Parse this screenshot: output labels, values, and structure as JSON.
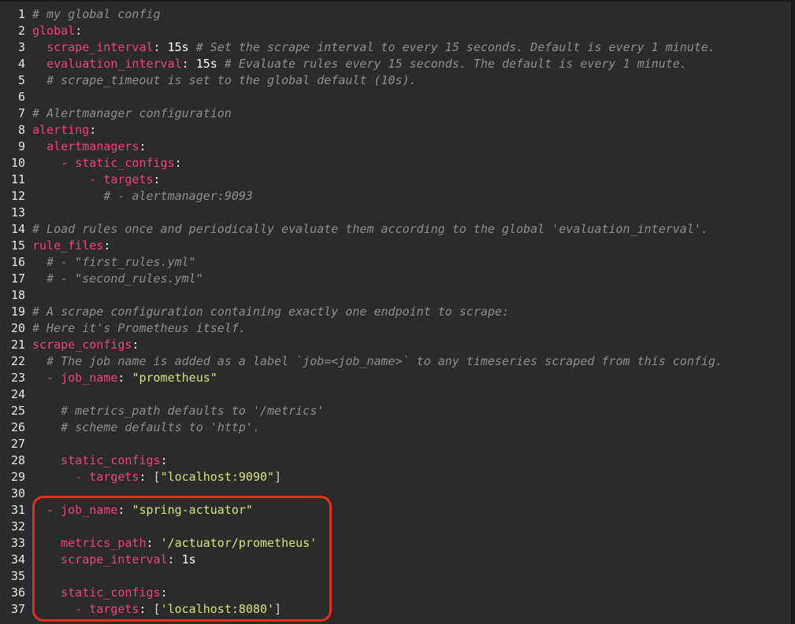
{
  "editor": {
    "lines": [
      {
        "num": "1",
        "indent": "",
        "tokens": [
          {
            "t": "c",
            "v": "# my global config"
          }
        ]
      },
      {
        "num": "2",
        "indent": "",
        "tokens": [
          {
            "t": "k",
            "v": "global"
          },
          {
            "t": "p",
            "v": ":"
          }
        ]
      },
      {
        "num": "3",
        "indent": "  ",
        "tokens": [
          {
            "t": "k",
            "v": "scrape_interval"
          },
          {
            "t": "p",
            "v": ": "
          },
          {
            "t": "n",
            "v": "15s"
          },
          {
            "t": "c",
            "v": " # Set the scrape interval to every 15 seconds. Default is every 1 minute."
          }
        ]
      },
      {
        "num": "4",
        "indent": "  ",
        "tokens": [
          {
            "t": "k",
            "v": "evaluation_interval"
          },
          {
            "t": "p",
            "v": ": "
          },
          {
            "t": "n",
            "v": "15s"
          },
          {
            "t": "c",
            "v": " # Evaluate rules every 15 seconds. The default is every 1 minute."
          }
        ]
      },
      {
        "num": "5",
        "indent": "  ",
        "tokens": [
          {
            "t": "c",
            "v": "# scrape_timeout is set to the global default (10s)."
          }
        ]
      },
      {
        "num": "6",
        "indent": "",
        "tokens": []
      },
      {
        "num": "7",
        "indent": "",
        "tokens": [
          {
            "t": "c",
            "v": "# Alertmanager configuration"
          }
        ]
      },
      {
        "num": "8",
        "indent": "",
        "tokens": [
          {
            "t": "k",
            "v": "alerting"
          },
          {
            "t": "p",
            "v": ":"
          }
        ]
      },
      {
        "num": "9",
        "indent": "  ",
        "tokens": [
          {
            "t": "k",
            "v": "alertmanagers"
          },
          {
            "t": "p",
            "v": ":"
          }
        ]
      },
      {
        "num": "10",
        "indent": "    ",
        "tokens": [
          {
            "t": "d",
            "v": "- "
          },
          {
            "t": "k",
            "v": "static_configs"
          },
          {
            "t": "p",
            "v": ":"
          }
        ]
      },
      {
        "num": "11",
        "indent": "        ",
        "tokens": [
          {
            "t": "d",
            "v": "- "
          },
          {
            "t": "k",
            "v": "targets"
          },
          {
            "t": "p",
            "v": ":"
          }
        ]
      },
      {
        "num": "12",
        "indent": "          ",
        "tokens": [
          {
            "t": "c",
            "v": "# - alertmanager:9093"
          }
        ]
      },
      {
        "num": "13",
        "indent": "",
        "tokens": []
      },
      {
        "num": "14",
        "indent": "",
        "tokens": [
          {
            "t": "c",
            "v": "# Load rules once and periodically evaluate them according to the global 'evaluation_interval'."
          }
        ]
      },
      {
        "num": "15",
        "indent": "",
        "tokens": [
          {
            "t": "k",
            "v": "rule_files"
          },
          {
            "t": "p",
            "v": ":"
          }
        ]
      },
      {
        "num": "16",
        "indent": "  ",
        "tokens": [
          {
            "t": "c",
            "v": "# - \"first_rules.yml\""
          }
        ]
      },
      {
        "num": "17",
        "indent": "  ",
        "tokens": [
          {
            "t": "c",
            "v": "# - \"second_rules.yml\""
          }
        ]
      },
      {
        "num": "18",
        "indent": "",
        "tokens": []
      },
      {
        "num": "19",
        "indent": "",
        "tokens": [
          {
            "t": "c",
            "v": "# A scrape configuration containing exactly one endpoint to scrape:"
          }
        ]
      },
      {
        "num": "20",
        "indent": "",
        "tokens": [
          {
            "t": "c",
            "v": "# Here it's Prometheus itself."
          }
        ]
      },
      {
        "num": "21",
        "indent": "",
        "tokens": [
          {
            "t": "k",
            "v": "scrape_configs"
          },
          {
            "t": "p",
            "v": ":"
          }
        ]
      },
      {
        "num": "22",
        "indent": "  ",
        "tokens": [
          {
            "t": "c",
            "v": "# The job name is added as a label `job=<job_name>` to any timeseries scraped from this config."
          }
        ]
      },
      {
        "num": "23",
        "indent": "  ",
        "tokens": [
          {
            "t": "d",
            "v": "- "
          },
          {
            "t": "k",
            "v": "job_name"
          },
          {
            "t": "p",
            "v": ": "
          },
          {
            "t": "s",
            "v": "\"prometheus\""
          }
        ]
      },
      {
        "num": "24",
        "indent": "",
        "tokens": []
      },
      {
        "num": "25",
        "indent": "    ",
        "tokens": [
          {
            "t": "c",
            "v": "# metrics_path defaults to '/metrics'"
          }
        ]
      },
      {
        "num": "26",
        "indent": "    ",
        "tokens": [
          {
            "t": "c",
            "v": "# scheme defaults to 'http'."
          }
        ]
      },
      {
        "num": "27",
        "indent": "",
        "tokens": []
      },
      {
        "num": "28",
        "indent": "    ",
        "tokens": [
          {
            "t": "k",
            "v": "static_configs"
          },
          {
            "t": "p",
            "v": ":"
          }
        ]
      },
      {
        "num": "29",
        "indent": "      ",
        "tokens": [
          {
            "t": "d",
            "v": "- "
          },
          {
            "t": "k",
            "v": "targets"
          },
          {
            "t": "p",
            "v": ": "
          },
          {
            "t": "b",
            "v": "["
          },
          {
            "t": "s",
            "v": "\"localhost:9090\""
          },
          {
            "t": "b",
            "v": "]"
          }
        ]
      },
      {
        "num": "30",
        "indent": "",
        "tokens": []
      },
      {
        "num": "31",
        "indent": "  ",
        "tokens": [
          {
            "t": "d",
            "v": "- "
          },
          {
            "t": "k",
            "v": "job_name"
          },
          {
            "t": "p",
            "v": ": "
          },
          {
            "t": "s",
            "v": "\"spring-actuator\""
          }
        ]
      },
      {
        "num": "32",
        "indent": "",
        "tokens": []
      },
      {
        "num": "33",
        "indent": "    ",
        "tokens": [
          {
            "t": "k",
            "v": "metrics_path"
          },
          {
            "t": "p",
            "v": ": "
          },
          {
            "t": "s",
            "v": "'/actuator/prometheus'"
          }
        ]
      },
      {
        "num": "34",
        "indent": "    ",
        "tokens": [
          {
            "t": "k",
            "v": "scrape_interval"
          },
          {
            "t": "p",
            "v": ": "
          },
          {
            "t": "n",
            "v": "1s"
          }
        ]
      },
      {
        "num": "35",
        "indent": "",
        "tokens": []
      },
      {
        "num": "36",
        "indent": "    ",
        "tokens": [
          {
            "t": "k",
            "v": "static_configs"
          },
          {
            "t": "p",
            "v": ":"
          }
        ]
      },
      {
        "num": "37",
        "indent": "      ",
        "tokens": [
          {
            "t": "d",
            "v": "- "
          },
          {
            "t": "k",
            "v": "targets"
          },
          {
            "t": "p",
            "v": ": "
          },
          {
            "t": "b",
            "v": "["
          },
          {
            "t": "s",
            "v": "'localhost:8080'"
          },
          {
            "t": "b",
            "v": "]"
          }
        ]
      }
    ]
  },
  "colors": {
    "background": "#2b2b2b",
    "key": "#f2417f",
    "comment": "#8f8f8f",
    "string": "#d8e47a",
    "highlight_border": "#e0321f"
  }
}
